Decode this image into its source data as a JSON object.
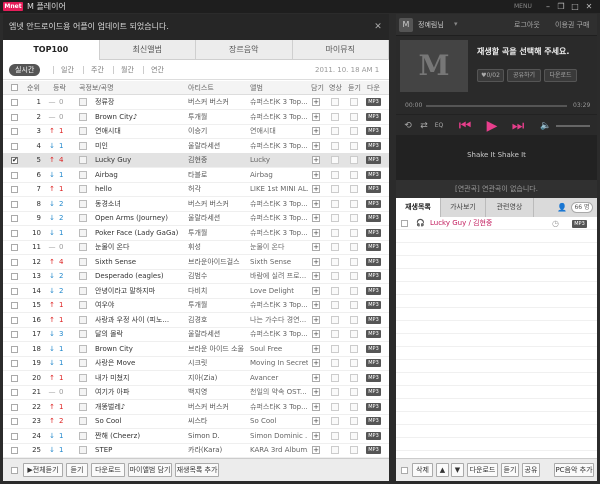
{
  "titlebar": {
    "logo": "Mnet",
    "title": "M 플레이어",
    "menu": "MENU"
  },
  "notice": {
    "text": "엠넷 안드로이드용 어플이 업데이트 되었습니다."
  },
  "tabs": [
    "TOP100",
    "최신앨범",
    "장르음악",
    "마이뮤직"
  ],
  "subtabs": [
    "실시간",
    "일간",
    "주간",
    "월간",
    "연간"
  ],
  "chart_date": "2011. 10. 18  AM 1",
  "columns": {
    "rank": "순위",
    "change": "등락",
    "info": "곡정보/곡명",
    "artist": "아티스트",
    "album": "앨범",
    "add": "담기",
    "video": "영상",
    "lyrics": "듣기",
    "download": "다운"
  },
  "rows": [
    {
      "rank": "1",
      "change": "0",
      "dir": "eq",
      "title": "정류장",
      "artist": "버스커 버스커",
      "album": "슈퍼스타K 3 Top..."
    },
    {
      "rank": "2",
      "change": "0",
      "dir": "eq",
      "title": "Brown City♪",
      "artist": "투개월",
      "album": "슈퍼스타K 3 Top..."
    },
    {
      "rank": "3",
      "change": "1",
      "dir": "up",
      "title": "연애시대",
      "artist": "이승기",
      "album": "연애시대"
    },
    {
      "rank": "4",
      "change": "1",
      "dir": "down",
      "title": "미인",
      "artist": "울랄라세션",
      "album": "슈퍼스타K 3 Top..."
    },
    {
      "rank": "5",
      "change": "4",
      "dir": "up",
      "title": "Lucky Guy",
      "artist": "김현중",
      "album": "Lucky"
    },
    {
      "rank": "6",
      "change": "1",
      "dir": "down",
      "title": "Airbag",
      "artist": "타블로",
      "album": "Airbag"
    },
    {
      "rank": "7",
      "change": "1",
      "dir": "up",
      "title": "hello",
      "artist": "허각",
      "album": "LIKE 1st MINI AL..."
    },
    {
      "rank": "8",
      "change": "2",
      "dir": "down",
      "title": "동경소녀",
      "artist": "버스커 버스커",
      "album": "슈퍼스타K 3 Top..."
    },
    {
      "rank": "9",
      "change": "2",
      "dir": "down",
      "title": "Open Arms (Journey)",
      "artist": "울랄라세션",
      "album": "슈퍼스타K 3 Top..."
    },
    {
      "rank": "10",
      "change": "1",
      "dir": "down",
      "title": "Poker Face (Lady GaGa)",
      "artist": "투개월",
      "album": "슈퍼스타K 3 Top..."
    },
    {
      "rank": "11",
      "change": "0",
      "dir": "eq",
      "title": "눈물이 온다",
      "artist": "휘성",
      "album": "눈물이 온다"
    },
    {
      "rank": "12",
      "change": "4",
      "dir": "up",
      "title": "Sixth Sense",
      "artist": "브라운아이드걸스",
      "album": "Sixth Sense"
    },
    {
      "rank": "13",
      "change": "2",
      "dir": "down",
      "title": "Desperado (eagles)",
      "artist": "김범수",
      "album": "바람에 실려 프로..."
    },
    {
      "rank": "14",
      "change": "2",
      "dir": "down",
      "title": "안녕이라고 말하지마",
      "artist": "다비치",
      "album": "Love Delight"
    },
    {
      "rank": "15",
      "change": "1",
      "dir": "up",
      "title": "여우야",
      "artist": "투개월",
      "album": "슈퍼스타K 3 Top..."
    },
    {
      "rank": "16",
      "change": "1",
      "dir": "up",
      "title": "사랑과 우정 사이 (피노...",
      "artist": "김경호",
      "album": "나는 가수다 경연..."
    },
    {
      "rank": "17",
      "change": "3",
      "dir": "down",
      "title": "달의 몰락",
      "artist": "울랄라세션",
      "album": "슈퍼스타K 3 Top..."
    },
    {
      "rank": "18",
      "change": "1",
      "dir": "down",
      "title": "Brown City",
      "artist": "브라운 아이드 소울",
      "album": "Soul Free"
    },
    {
      "rank": "19",
      "change": "1",
      "dir": "down",
      "title": "사랑은 Move",
      "artist": "시크릿",
      "album": "Moving In Secret"
    },
    {
      "rank": "20",
      "change": "1",
      "dir": "up",
      "title": "내가 미쳤지",
      "artist": "지아(Zia)",
      "album": "Avancer"
    },
    {
      "rank": "21",
      "change": "0",
      "dir": "eq",
      "title": "여기가 아파",
      "artist": "백지영",
      "album": "천일의 약속 OST..."
    },
    {
      "rank": "22",
      "change": "1",
      "dir": "up",
      "title": "개똥벌레♪",
      "artist": "버스커 버스커",
      "album": "슈퍼스타K 3 Top..."
    },
    {
      "rank": "23",
      "change": "2",
      "dir": "up",
      "title": "So Cool",
      "artist": "씨스타",
      "album": "So Cool"
    },
    {
      "rank": "24",
      "change": "1",
      "dir": "down",
      "title": "짠해 (Cheerz)",
      "artist": "Simon D.",
      "album": "Simon Dominic ..."
    },
    {
      "rank": "25",
      "change": "1",
      "dir": "down",
      "title": "STEP",
      "artist": "카라(Kara)",
      "album": "KARA 3rd Album..."
    }
  ],
  "selected_row": "5",
  "mp3_label": "MP3",
  "bottom": {
    "play_all": "▶전체듣기",
    "listen": "듣기",
    "download": "다운로드",
    "add_album": "마이앨범 담기",
    "add_playlist": "재생목록 추가"
  },
  "user": {
    "name": "정예림님",
    "logout": "로그아웃",
    "subscription": "이용권 구매"
  },
  "player": {
    "message": "재생할 곡을 선택해 주세요.",
    "like": "♥0/02",
    "share": "공유하기",
    "download": "다운로드",
    "time_current": "00:00",
    "time_total": "03:29"
  },
  "lyrics": {
    "line": "Shake It Shake It"
  },
  "related": {
    "text": "[연관곡] 연관곡이 없습니다."
  },
  "playlist_tabs": [
    "재생목록",
    "가사보기",
    "관련영상"
  ],
  "playlist_count": "66 명",
  "playlist": [
    {
      "title": "Lucky Guy / 김현중"
    }
  ],
  "playlist_bottom": {
    "delete": "삭제",
    "up": "▲",
    "down": "▼",
    "download": "다운로드",
    "listen": "듣기",
    "share": "공유",
    "pc_add": "PC음악 추가"
  }
}
